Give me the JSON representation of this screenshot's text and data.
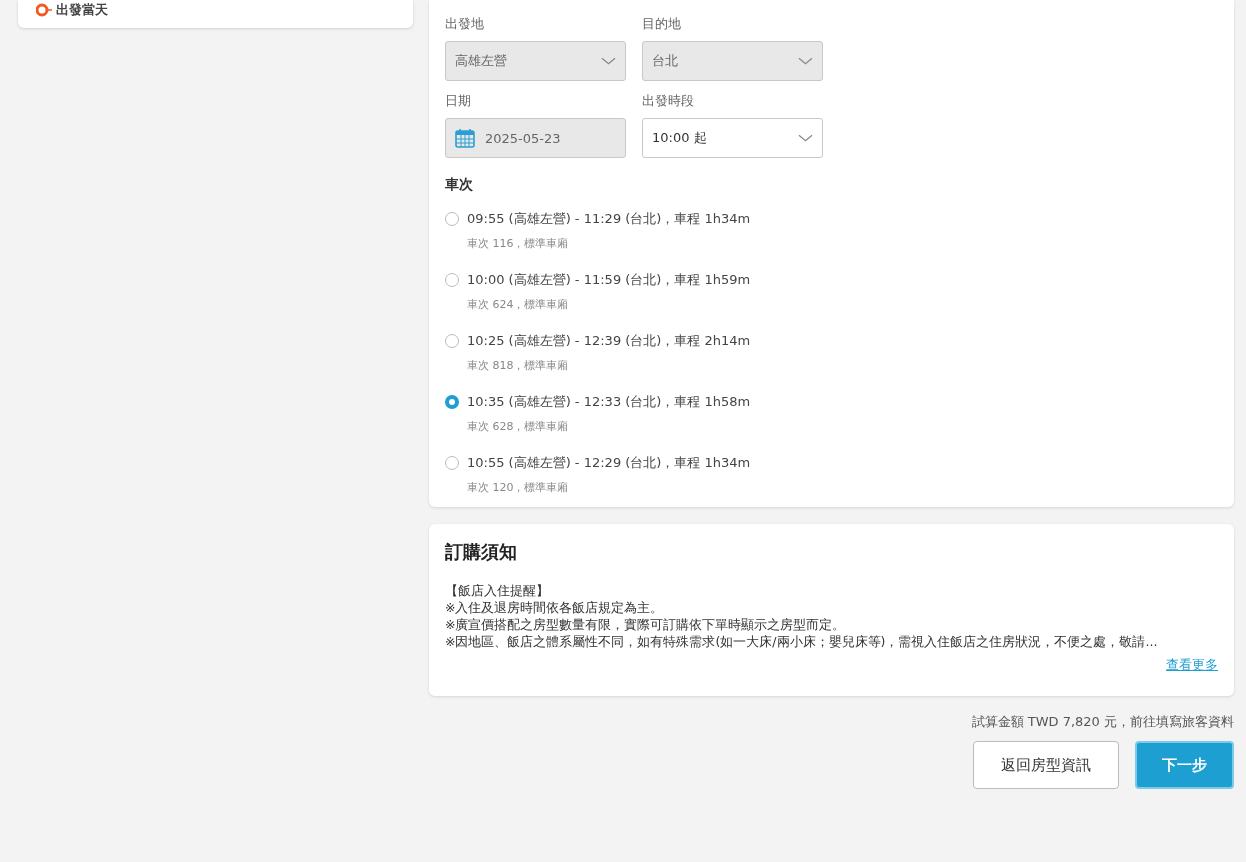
{
  "timeline": {
    "items": [
      {
        "label": "出發當天"
      }
    ]
  },
  "train_form": {
    "fields": [
      {
        "label": "出發地",
        "value": "高雄左營",
        "kind": "select",
        "disabled": true
      },
      {
        "label": "目的地",
        "value": "台北",
        "kind": "select",
        "disabled": true
      },
      {
        "label": "日期",
        "value": "2025-05-23",
        "kind": "date",
        "disabled": true
      },
      {
        "label": "出發時段",
        "value": "10:00 起",
        "kind": "select",
        "disabled": false
      }
    ],
    "trains_heading": "車次",
    "trains": [
      {
        "label": "09:55 (高雄左營) - 11:29 (台北)，車程 1h34m",
        "detail": "車次 116，標準車廂",
        "selected": false
      },
      {
        "label": "10:00 (高雄左營) - 11:59 (台北)，車程 1h59m",
        "detail": "車次 624，標準車廂",
        "selected": false
      },
      {
        "label": "10:25 (高雄左營) - 12:39 (台北)，車程 2h14m",
        "detail": "車次 818，標準車廂",
        "selected": false
      },
      {
        "label": "10:35 (高雄左營) - 12:33 (台北)，車程 1h58m",
        "detail": "車次 628，標準車廂",
        "selected": true
      },
      {
        "label": "10:55 (高雄左營) - 12:29 (台北)，車程 1h34m",
        "detail": "車次 120，標準車廂",
        "selected": false
      }
    ]
  },
  "notice": {
    "title": "訂購須知",
    "lines": [
      "【飯店入住提醒】",
      "※入住及退房時間依各飯店規定為主。",
      "※廣宣價搭配之房型數量有限，實際可訂購依下單時顯示之房型而定。",
      "※因地區、飯店之體系屬性不同，如有特殊需求(如一大床/兩小床；嬰兒床等)，需視入住飯店之住房狀況，不便之處，敬請..."
    ],
    "more_link": "查看更多"
  },
  "footer": {
    "summary": "試算金額 TWD 7,820 元，前往填寫旅客資料",
    "buttons": [
      {
        "label": "返回房型資訊",
        "kind": "secondary"
      },
      {
        "label": "下一步",
        "kind": "primary"
      }
    ]
  }
}
